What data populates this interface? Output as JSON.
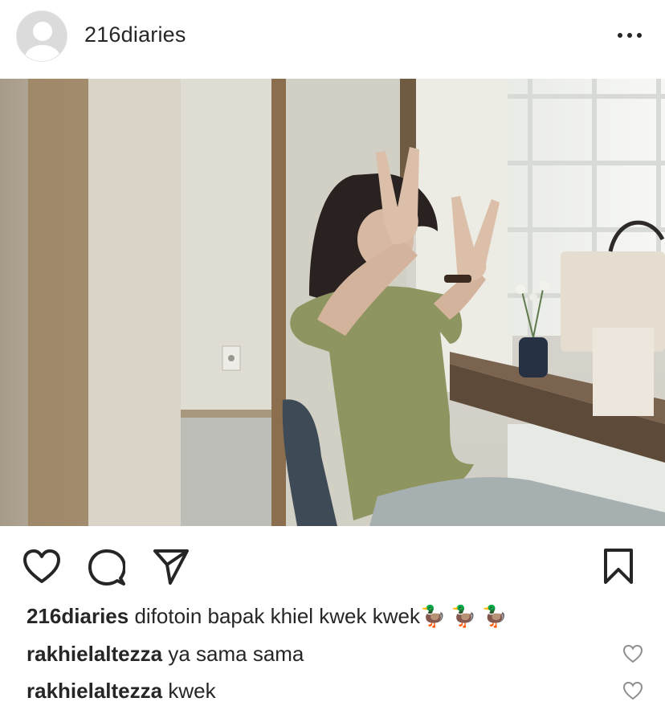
{
  "post": {
    "username": "216diaries",
    "more_icon": "more-horizontal-icon"
  },
  "actions": {
    "like_icon": "heart-icon",
    "comment_icon": "comment-icon",
    "share_icon": "send-icon",
    "save_icon": "bookmark-icon"
  },
  "caption": {
    "username": "216diaries",
    "text": "difotoin bapak khiel kwek kwek",
    "emoji": "🦆🦆🦆"
  },
  "comments": [
    {
      "username": "rakhielaltezza",
      "text": "ya sama sama"
    },
    {
      "username": "rakhielaltezza",
      "text": "kwek"
    }
  ],
  "colors": {
    "text": "#262626",
    "icon_gray": "#8e8e8e"
  }
}
